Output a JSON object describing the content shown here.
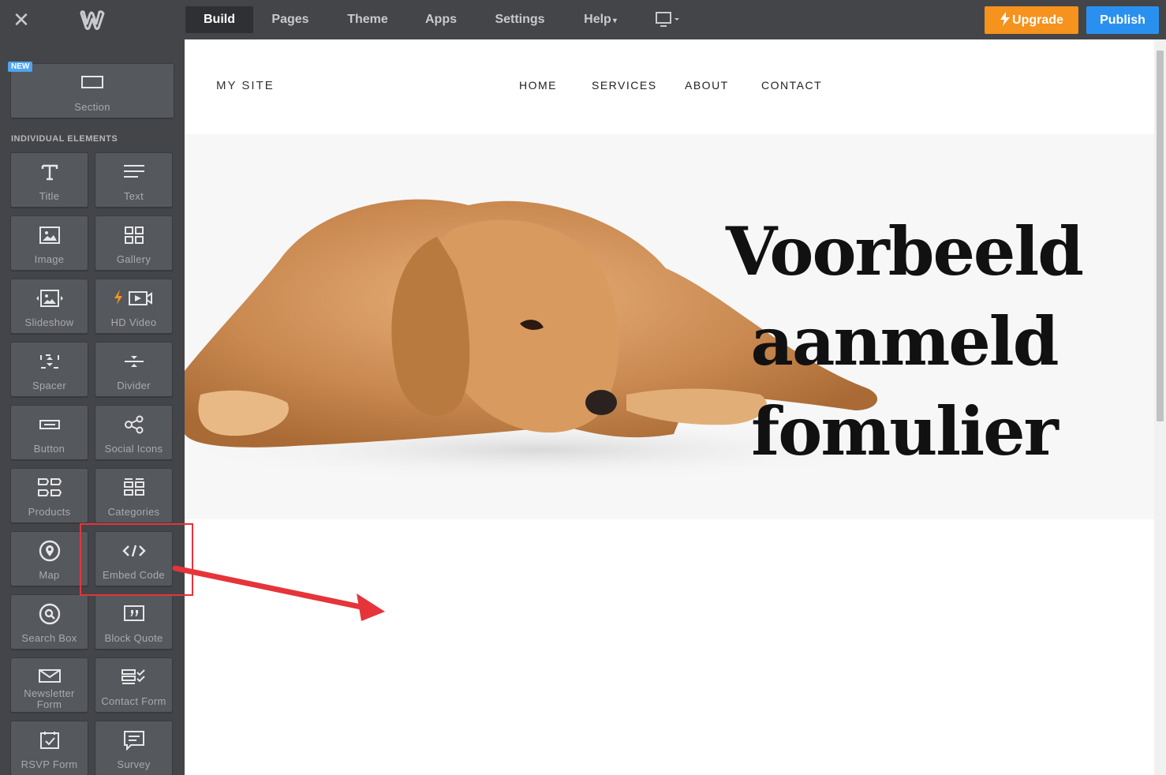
{
  "topbar": {
    "close_icon": "close-icon",
    "logo_icon": "weebly-logo-icon",
    "tabs": [
      {
        "label": "Build",
        "active": true
      },
      {
        "label": "Pages"
      },
      {
        "label": "Theme"
      },
      {
        "label": "Apps"
      },
      {
        "label": "Settings"
      },
      {
        "label": "Help",
        "caret": "▾"
      }
    ],
    "device_icon": "desktop-icon",
    "upgrade_label": "Upgrade",
    "publish_label": "Publish"
  },
  "sidebar": {
    "new_badge": "NEW",
    "section_label": "Section",
    "heading": "INDIVIDUAL ELEMENTS",
    "elements": [
      {
        "label": "Title",
        "icon": "title-icon"
      },
      {
        "label": "Text",
        "icon": "text-icon"
      },
      {
        "label": "Image",
        "icon": "image-icon"
      },
      {
        "label": "Gallery",
        "icon": "gallery-icon"
      },
      {
        "label": "Slideshow",
        "icon": "slideshow-icon"
      },
      {
        "label": "HD Video",
        "icon": "video-icon"
      },
      {
        "label": "Spacer",
        "icon": "spacer-icon"
      },
      {
        "label": "Divider",
        "icon": "divider-icon"
      },
      {
        "label": "Button",
        "icon": "button-icon"
      },
      {
        "label": "Social Icons",
        "icon": "share-icon"
      },
      {
        "label": "Products",
        "icon": "products-icon"
      },
      {
        "label": "Categories",
        "icon": "categories-icon"
      },
      {
        "label": "Map",
        "icon": "map-pin-icon"
      },
      {
        "label": "Embed Code",
        "icon": "code-icon"
      },
      {
        "label": "Search Box",
        "icon": "search-icon"
      },
      {
        "label": "Block Quote",
        "icon": "quote-icon"
      },
      {
        "label": "Newsletter Form",
        "icon": "envelope-icon"
      },
      {
        "label": "Contact Form",
        "icon": "contact-form-icon"
      },
      {
        "label": "RSVP Form",
        "icon": "rsvp-icon"
      },
      {
        "label": "Survey",
        "icon": "survey-icon"
      }
    ]
  },
  "site": {
    "title": "MY SITE",
    "nav": [
      "HOME",
      "SERVICES",
      "ABOUT",
      "CONTACT"
    ],
    "hero_lines": [
      "Voorbeeld",
      "aanmeld",
      "fomulier"
    ]
  },
  "colors": {
    "toolbar": "#434549",
    "upgrade": "#f6921e",
    "publish": "#2a90f0",
    "highlight": "#e5343a"
  }
}
